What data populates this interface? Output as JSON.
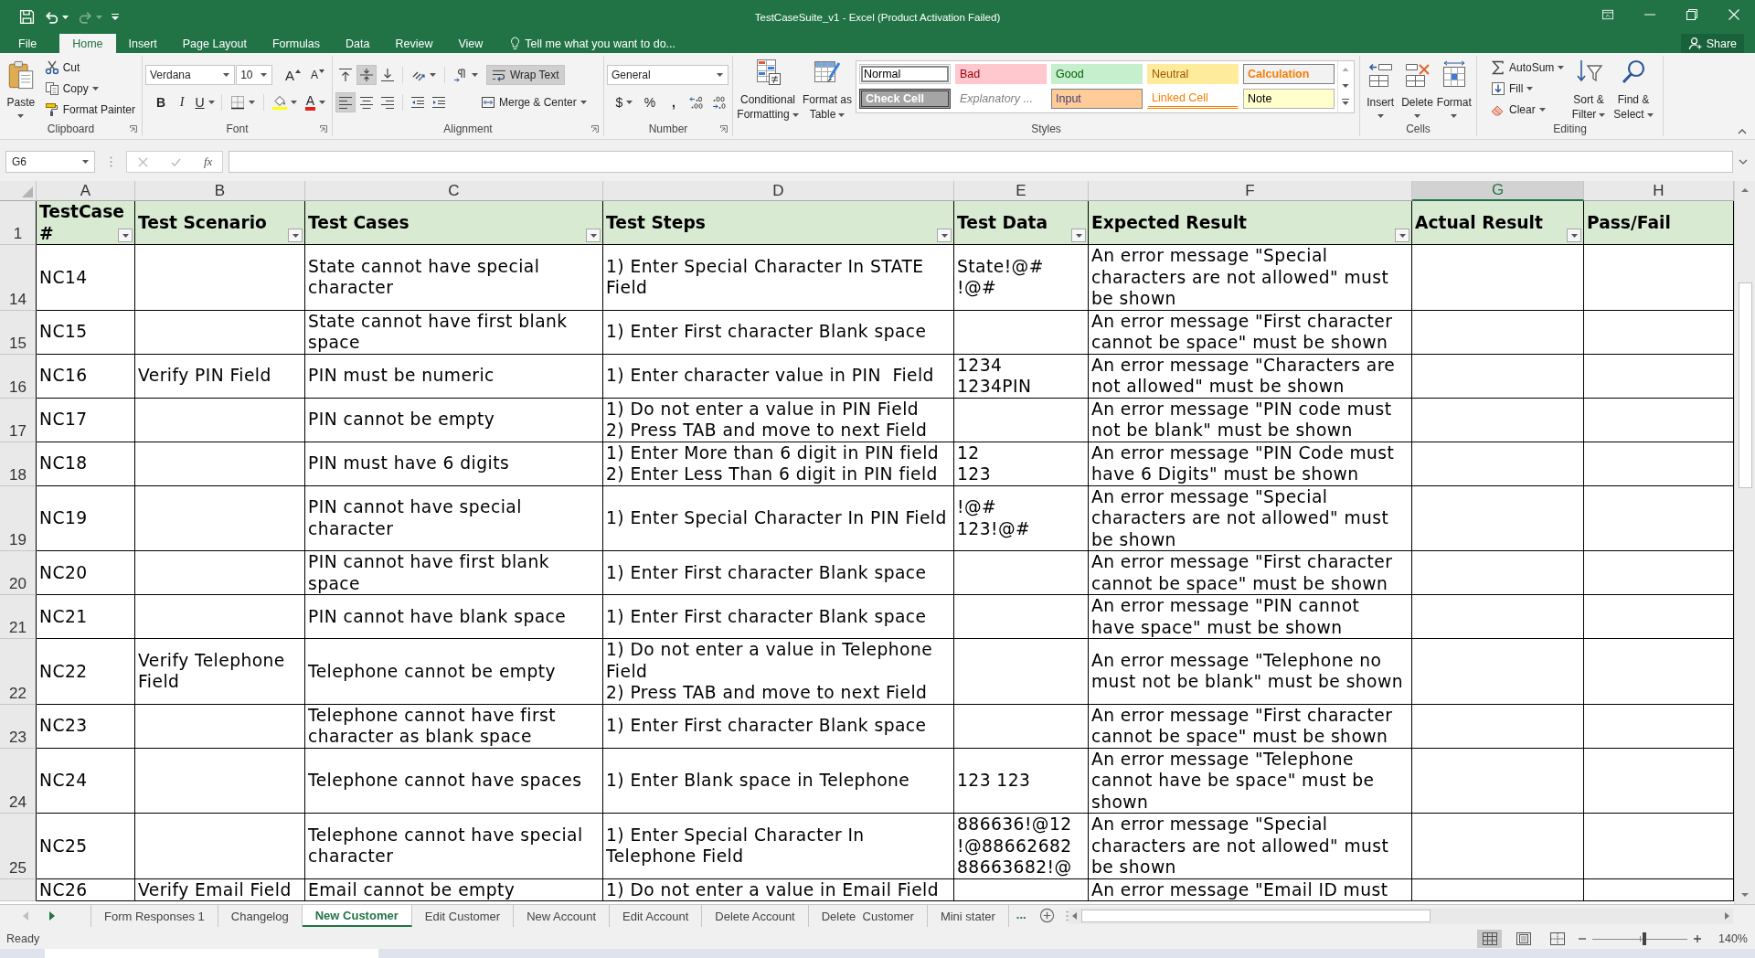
{
  "title_bar": {
    "title": "TestCaseSuite_v1 - Excel (Product Activation Failed)",
    "quick_access": [
      {
        "kind": "save",
        "disabled": false
      },
      {
        "kind": "undo",
        "disabled": false
      },
      {
        "kind": "redo",
        "disabled": true
      }
    ]
  },
  "ribbon_tabs": [
    {
      "label": "File",
      "selected": false
    },
    {
      "label": "Home",
      "selected": true
    },
    {
      "label": "Insert",
      "selected": false
    },
    {
      "label": "Page Layout",
      "selected": false
    },
    {
      "label": "Formulas",
      "selected": false
    },
    {
      "label": "Data",
      "selected": false
    },
    {
      "label": "Review",
      "selected": false
    },
    {
      "label": "View",
      "selected": false
    }
  ],
  "tell_me": {
    "placeholder": "Tell me what you want to do..."
  },
  "share": {
    "label": "Share"
  },
  "ribbon": {
    "clipboard": {
      "label": "Clipboard",
      "paste": "Paste",
      "cut": "Cut",
      "copy": "Copy",
      "format_painter": "Format Painter"
    },
    "font": {
      "label": "Font",
      "font_name": "Verdana",
      "font_size": "10",
      "grow": "A",
      "shrink": "A",
      "bold": "B",
      "italic": "I",
      "underline": "U",
      "font_color": "A"
    },
    "alignment": {
      "label": "Alignment",
      "vertical": [
        {
          "kind": "top",
          "selected": false
        },
        {
          "kind": "middle",
          "selected": true
        },
        {
          "kind": "bottom",
          "selected": false
        }
      ],
      "horizontal": [
        {
          "kind": "left",
          "selected": true
        },
        {
          "kind": "center",
          "selected": false
        },
        {
          "kind": "right",
          "selected": false
        }
      ],
      "wrap_text": {
        "label": "Wrap Text",
        "on": true
      },
      "merge": "Merge & Center"
    },
    "number": {
      "label": "Number",
      "format": "General",
      "currency": "$",
      "percent": "%",
      "comma": ","
    },
    "styles": {
      "label": "Styles",
      "conditional": "Conditional Formatting",
      "format_table": "Format as Table",
      "gallery": [
        {
          "label": "Normal",
          "kind": "normal",
          "selected": true
        },
        {
          "label": "Bad",
          "kind": "bad",
          "selected": false
        },
        {
          "label": "Good",
          "kind": "good",
          "selected": false
        },
        {
          "label": "Neutral",
          "kind": "neutral",
          "selected": false
        },
        {
          "label": "Calculation",
          "kind": "calculation",
          "selected": false
        },
        {
          "label": "Check Cell",
          "kind": "check",
          "selected": false
        },
        {
          "label": "Explanatory ...",
          "kind": "explanatory",
          "selected": false
        },
        {
          "label": "Input",
          "kind": "input",
          "selected": false
        },
        {
          "label": "Linked Cell",
          "kind": "linked",
          "selected": false
        },
        {
          "label": "Note",
          "kind": "note",
          "selected": false
        }
      ]
    },
    "cells": {
      "label": "Cells",
      "insert": "Insert",
      "delete": "Delete",
      "format": "Format"
    },
    "editing": {
      "label": "Editing",
      "autosum": "AutoSum",
      "fill": "Fill",
      "clear": "Clear",
      "sort": "Sort & Filter",
      "find": "Find & Select"
    }
  },
  "formula_bar": {
    "name_box": "G6",
    "function_label": "fx"
  },
  "sheet": {
    "columns": [
      {
        "letter": "A",
        "selected": false
      },
      {
        "letter": "B",
        "selected": false
      },
      {
        "letter": "C",
        "selected": false
      },
      {
        "letter": "D",
        "selected": false
      },
      {
        "letter": "E",
        "selected": false
      },
      {
        "letter": "F",
        "selected": false
      },
      {
        "letter": "G",
        "selected": true
      },
      {
        "letter": "H",
        "selected": false
      }
    ],
    "header": {
      "number": "1",
      "cells": [
        {
          "label": "TestCase #",
          "filter": true
        },
        {
          "label": "Test Scenario",
          "filter": true
        },
        {
          "label": "Test Cases",
          "filter": true
        },
        {
          "label": "Test Steps",
          "filter": true
        },
        {
          "label": "Test Data",
          "filter": true
        },
        {
          "label": "Expected Result",
          "filter": true
        },
        {
          "label": "Actual Result",
          "filter": true
        },
        {
          "label": "Pass/Fail",
          "filter": false
        }
      ]
    },
    "rows": [
      {
        "number": "14",
        "id": "NC14",
        "case": "State cannot have special character",
        "steps": "1) Enter Special Character In STATE Field",
        "data": "State!@#\n!@#",
        "expected": "An error message \"Special characters are not allowed\" must be shown"
      },
      {
        "number": "15",
        "id": "NC15",
        "case": "State cannot have first blank space",
        "steps": "1) Enter First character Blank space",
        "expected": "An error message \"First character cannot be space\" must be shown"
      },
      {
        "number": "16",
        "id": "NC16",
        "scenario": "Verify PIN Field",
        "case": "PIN must be numeric",
        "steps": "1) Enter character value in PIN  Field",
        "data": "1234\n1234PIN",
        "expected": "An error message \"Characters are not allowed\" must be shown"
      },
      {
        "number": "17",
        "id": "NC17",
        "case": "PIN cannot be empty",
        "steps": "1) Do not enter a value in PIN Field\n2) Press TAB and move to next Field",
        "expected": "An error message \"PIN code must not be blank\" must be shown"
      },
      {
        "number": "18",
        "id": "NC18",
        "case": "PIN must have 6 digits",
        "steps": "1) Enter More than 6 digit in PIN field\n2) Enter Less Than 6 digit in PIN field",
        "data": "12\n123",
        "expected": "An error message \"PIN Code must have 6 Digits\" must be shown"
      },
      {
        "number": "19",
        "id": "NC19",
        "case": "PIN cannot have special character",
        "steps": "1) Enter Special Character In PIN Field",
        "data": "!@#\n123!@#",
        "expected": "An error message \"Special characters are not allowed\" must be shown"
      },
      {
        "number": "20",
        "id": "NC20",
        "case": "PIN cannot have first blank space",
        "steps": "1) Enter First character Blank space",
        "expected": "An error message \"First character cannot be space\" must be shown"
      },
      {
        "number": "21",
        "id": "NC21",
        "case": "PIN cannot have blank space",
        "steps": "1) Enter First character Blank space",
        "expected": "An error message \"PIN cannot have space\" must be shown"
      },
      {
        "number": "22",
        "id": "NC22",
        "scenario": "Verify Telephone Field",
        "case": "Telephone cannot be empty",
        "steps": "1) Do not enter a value in Telephone Field\n2) Press TAB and move to next Field",
        "expected": "An error message \"Telephone no must not be blank\" must be shown"
      },
      {
        "number": "23",
        "id": "NC23",
        "case": "Telephone cannot have first character as blank space",
        "steps": "1) Enter First character Blank space",
        "expected": "An error message \"First character cannot be space\" must be shown"
      },
      {
        "number": "24",
        "id": "NC24",
        "case": "Telephone cannot have spaces",
        "steps": "1) Enter Blank space in Telephone",
        "data": "123 123",
        "expected": "An error message \"Telephone cannot have be space\" must be shown"
      },
      {
        "number": "25",
        "id": "NC25",
        "case": "Telephone cannot have special character",
        "steps": "1) Enter Special Character In Telephone Field",
        "data": "886636!@12\n!@88662682\n88663682!@",
        "expected": "An error message \"Special characters are not allowed\" must be shown"
      },
      {
        "id": "NC26",
        "scenario": "Verify Email Field",
        "case": "Email cannot be empty",
        "steps": "1) Do not enter a value in Email Field",
        "expected": "An error message \"Email ID must"
      }
    ]
  },
  "sheet_tabs": {
    "tabs": [
      {
        "label": "Form Responses 1",
        "selected": false
      },
      {
        "label": "Changelog",
        "selected": false
      },
      {
        "label": "New Customer",
        "selected": true
      },
      {
        "label": "Edit Customer",
        "selected": false
      },
      {
        "label": "New Account",
        "selected": false
      },
      {
        "label": "Edit Account",
        "selected": false
      },
      {
        "label": "Delete Account",
        "selected": false
      },
      {
        "label": "Delete  Customer",
        "selected": false
      },
      {
        "label": "Mini stater",
        "selected": false
      }
    ],
    "more": "..."
  },
  "status_bar": {
    "status": "Ready",
    "views": [
      {
        "kind": "normal",
        "selected": true
      },
      {
        "kind": "page_layout",
        "selected": false
      },
      {
        "kind": "page_break",
        "selected": false
      }
    ],
    "zoom": {
      "level": 0.55,
      "reading": "140%"
    }
  }
}
